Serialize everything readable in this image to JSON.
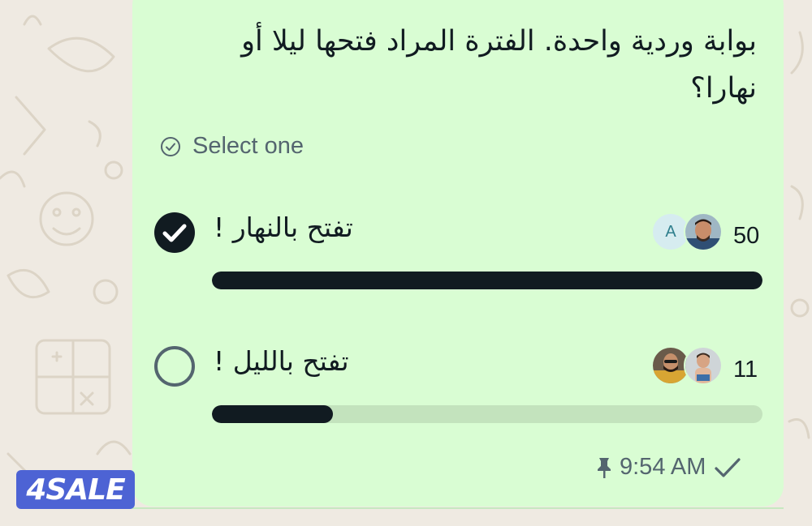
{
  "colors": {
    "bubble_bg": "#d9fdd3",
    "wallpaper_bg": "#efeae2",
    "text_primary": "#111b21",
    "text_secondary": "#54656f",
    "bar_fill": "#111b21",
    "bar_track": "#c3e3bd",
    "logo_bg": "#4d63d4"
  },
  "message": {
    "question": "بوابة وردية واحدة. الفترة المراد فتحها ليلا أو نهارا؟",
    "select_hint": "Select one",
    "select_hint_icon": "check-circle-icon",
    "time": "9:54 AM",
    "pin_icon": "pin-icon",
    "status_icon": "single-check-icon"
  },
  "poll": {
    "options": [
      {
        "label": "تفتح بالنهار !",
        "votes": "50",
        "selected": true,
        "share": 1.0,
        "voters": [
          {
            "kind": "letter",
            "letter": "A"
          },
          {
            "kind": "photo"
          }
        ]
      },
      {
        "label": "تفتح بالليل !",
        "votes": "11",
        "selected": false,
        "share": 0.22,
        "voters": [
          {
            "kind": "photo"
          },
          {
            "kind": "photo"
          }
        ]
      }
    ]
  },
  "watermark": {
    "text": "4SALE"
  }
}
